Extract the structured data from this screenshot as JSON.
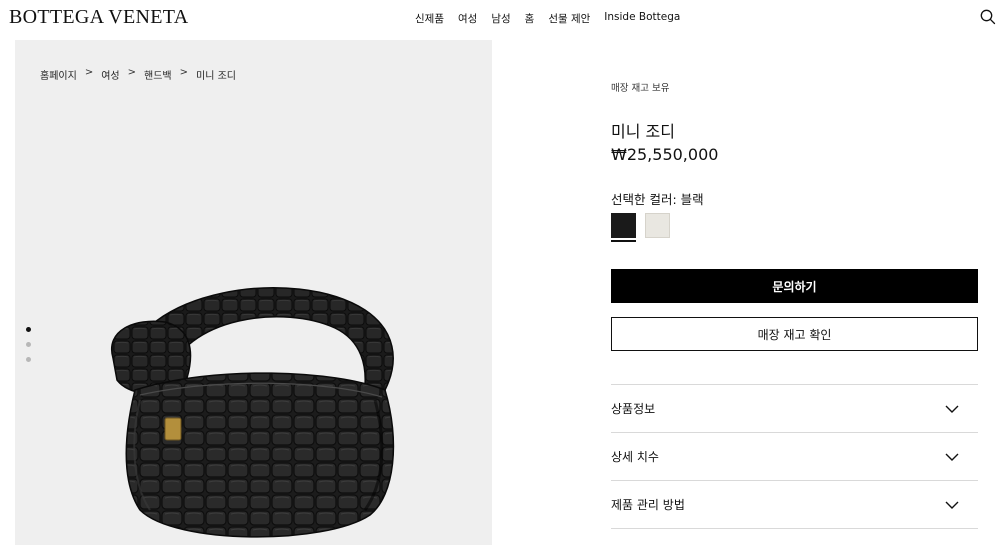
{
  "header": {
    "logo": "BOTTEGA VENETA",
    "nav": [
      "신제품",
      "여성",
      "남성",
      "홈",
      "선물 제안",
      "Inside Bottega"
    ],
    "search_icon": "search-icon"
  },
  "breadcrumb": [
    "홈페이지",
    "여성",
    "핸드백",
    "미니 조디"
  ],
  "breadcrumb_separator": ">",
  "gallery": {
    "image": "black crocodile leather knotted hobo bag",
    "dots_count": 3,
    "active_dot": 0,
    "background_color": "#efefef"
  },
  "product": {
    "stock_note": "매장 재고 보유",
    "name": "미니 조디",
    "price": "₩25,550,000",
    "color_label": "선택한 컬러: 블랙",
    "swatches": [
      {
        "name": "black",
        "color": "#1a1a1a",
        "selected": true
      },
      {
        "name": "white",
        "color": "#e9e7e1",
        "selected": false
      }
    ]
  },
  "actions": {
    "inquire": "문의하기",
    "check_stock": "매장 재고 확인"
  },
  "accordion": [
    {
      "label": "상품정보",
      "icon": "chevron-down-icon"
    },
    {
      "label": "상세 치수",
      "icon": "chevron-down-icon"
    },
    {
      "label": "제품 관리 방법",
      "icon": "chevron-down-icon"
    }
  ]
}
